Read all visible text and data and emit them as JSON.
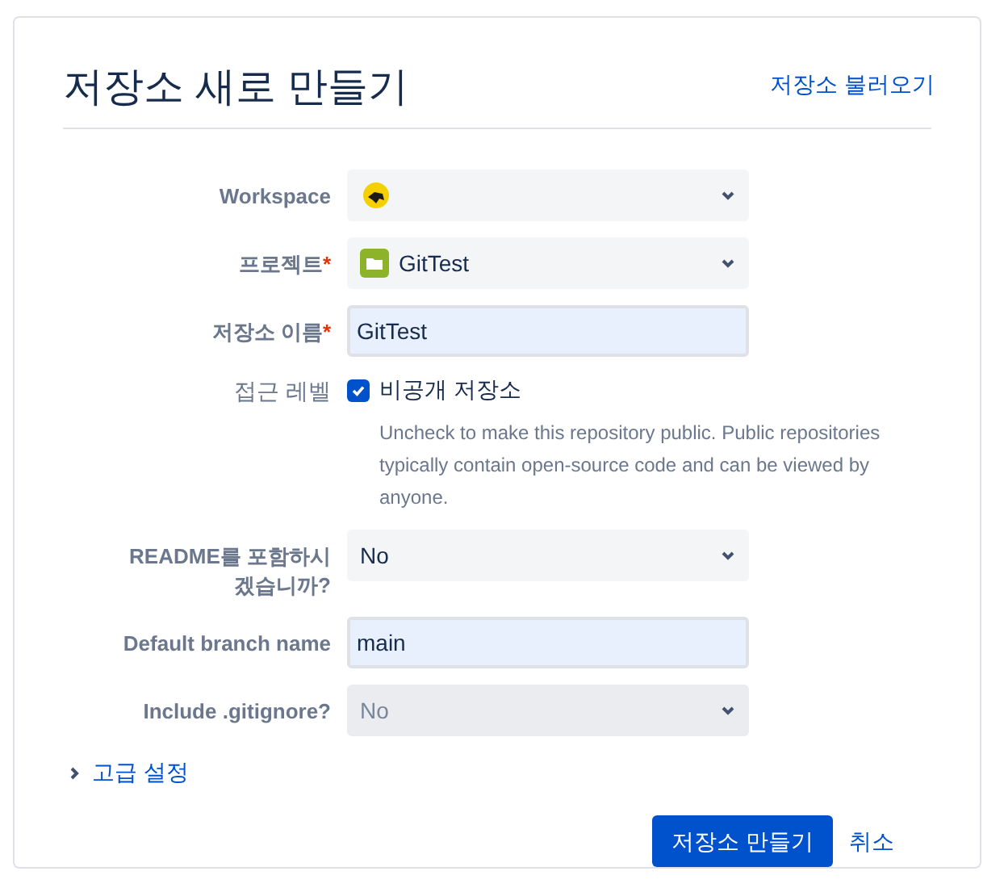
{
  "title": "저장소 새로 만들기",
  "import_link": "저장소 불러오기",
  "fields": [
    {
      "kind": "select",
      "label": "Workspace"
    },
    {
      "kind": "select",
      "label": "프로젝트",
      "required_mark": "*",
      "value": "GitTest"
    },
    {
      "kind": "input",
      "label": "저장소 이름",
      "required_mark": "*",
      "value": "GitTest"
    },
    {
      "kind": "checkbox",
      "label": "접근 레벨",
      "option": "비공개 저장소",
      "checked": true,
      "help": "Uncheck to make this repository public. Public repositories typically contain open-source code and can be viewed by anyone."
    },
    {
      "kind": "select",
      "label": "README를 포함하시\n겠습니까?",
      "value": "No",
      "disabled": false
    },
    {
      "kind": "input",
      "label": "Default branch name",
      "value": "main"
    },
    {
      "kind": "select",
      "label": "Include .gitignore?",
      "value": "No",
      "disabled": true
    }
  ],
  "advanced": {
    "label": "고급 설정",
    "expanded": false
  },
  "buttons": {
    "create": "저장소 만들기",
    "cancel": "취소"
  }
}
